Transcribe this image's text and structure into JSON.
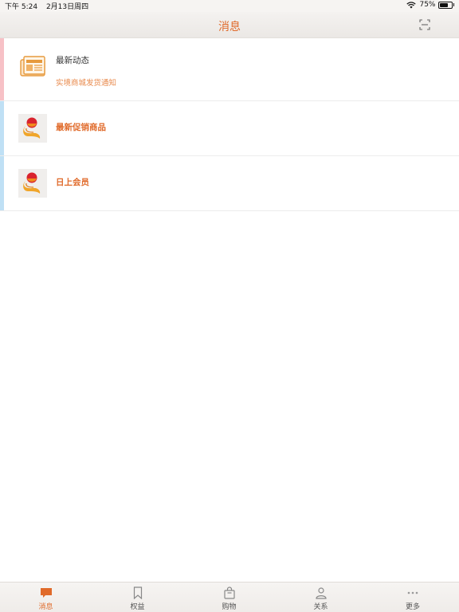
{
  "status_bar": {
    "time": "下午 5:24",
    "date": "2月13日周四",
    "battery": "75%",
    "battery_level": 0.75
  },
  "nav": {
    "title": "消息",
    "scan_icon": "scan-icon"
  },
  "messages": [
    {
      "title": "最新动态",
      "subtitle": "实境商城发货通知",
      "icon": "news-icon",
      "accent": "#f7c1c6"
    },
    {
      "title": "最新促销商品",
      "icon": "brand-logo-icon",
      "accent": "#bfe0f5"
    },
    {
      "title": "日上会员",
      "icon": "brand-logo-icon",
      "accent": "#bfe0f5"
    }
  ],
  "tabs": [
    {
      "label": "消息",
      "icon": "message-icon",
      "active": true
    },
    {
      "label": "权益",
      "icon": "bookmark-icon",
      "active": false
    },
    {
      "label": "购物",
      "icon": "shopping-bag-icon",
      "active": false
    },
    {
      "label": "关系",
      "icon": "contacts-icon",
      "active": false
    },
    {
      "label": "更多",
      "icon": "more-icon",
      "active": false
    }
  ],
  "colors": {
    "accent_orange": "#e06a2a",
    "subtitle_orange": "#e8884a"
  }
}
